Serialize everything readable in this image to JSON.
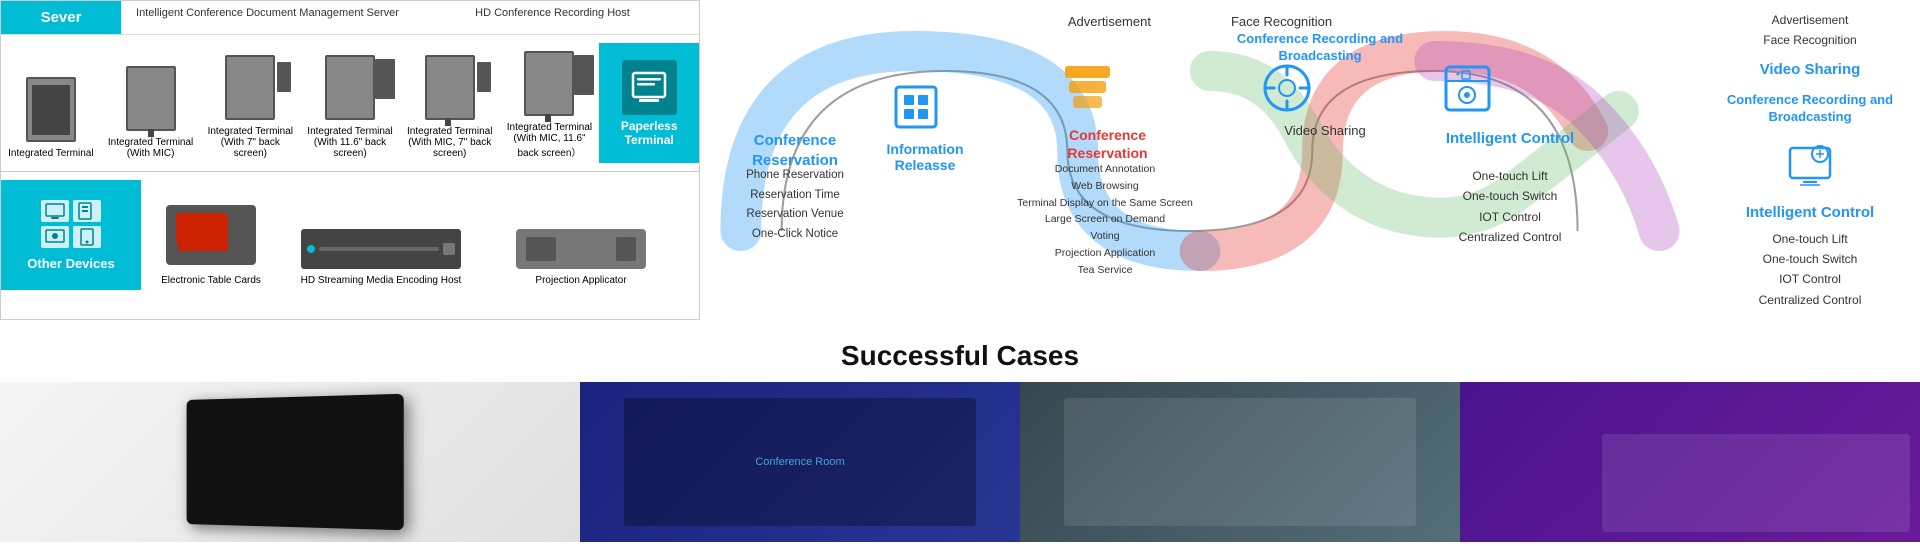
{
  "server": {
    "label": "Sever"
  },
  "header_items": [
    {
      "label": "Intelligent Conference Document Management Server"
    },
    {
      "label": "HD Conference Recording Host"
    }
  ],
  "devices_top": [
    {
      "label": "Integrated Terminal"
    },
    {
      "label": "Integrated Terminal (With MIC)"
    },
    {
      "label": "Integrated Terminal (With 7\" back screen)"
    },
    {
      "label": "Integrated Terminal (With 11.6\" back screen)"
    },
    {
      "label": "Integrated Terminal (With MIC, 7\" back screen)"
    },
    {
      "label": "Integrated Terminal (With MIC, 11.6\" back screen）"
    }
  ],
  "paperless_terminal": {
    "label": "Paperless Terminal"
  },
  "other_devices": {
    "label": "Other Devices"
  },
  "devices_bottom": [
    {
      "label": "Electronic Table Cards"
    },
    {
      "label": "HD Streaming Media Encoding Host"
    },
    {
      "label": "Projection Applicator"
    }
  ],
  "top_labels": [
    {
      "label": "Advertisement"
    },
    {
      "label": "Face Recognition"
    }
  ],
  "diagram": {
    "sections": [
      {
        "label": "Conference Reservation",
        "color": "#2196f3",
        "sub_items": [
          "Phone Reservation",
          "Reservation Time",
          "Reservation Venue",
          "One-Click Notice"
        ]
      },
      {
        "label": "Information Releasse",
        "color": "#2196f3"
      },
      {
        "label": "Conference Reservation",
        "color": "#e74c3c",
        "sub_items": [
          "Document Annotation",
          "Web Browsing",
          "Terminal Display on the Same Screen",
          "Large Screen on Demand",
          "Voting",
          "Projection Application",
          "Tea Service"
        ]
      },
      {
        "label": "Conference Recording and Broadcasting",
        "color": "#2196f3",
        "sub_items": [
          "Video Sharing"
        ]
      },
      {
        "label": "Intelligent Control",
        "color": "#2196f3",
        "sub_items": [
          "One-touch Lift",
          "One-touch Switch",
          "IOT Control",
          "Centralized Control"
        ]
      }
    ]
  },
  "right_panel": {
    "top_labels": [
      "Advertisement",
      "Face Recognition"
    ],
    "video_sharing": "Video Sharing",
    "conf_rec_broadcast": "Conference Recording and Broadcasting",
    "intelligent_control": "Intelligent Control",
    "sub_items": [
      "One-touch Lift",
      "One-touch Switch",
      "IOT Control",
      "Centralized Control"
    ]
  },
  "successful_cases": {
    "title": "Successful Cases"
  }
}
